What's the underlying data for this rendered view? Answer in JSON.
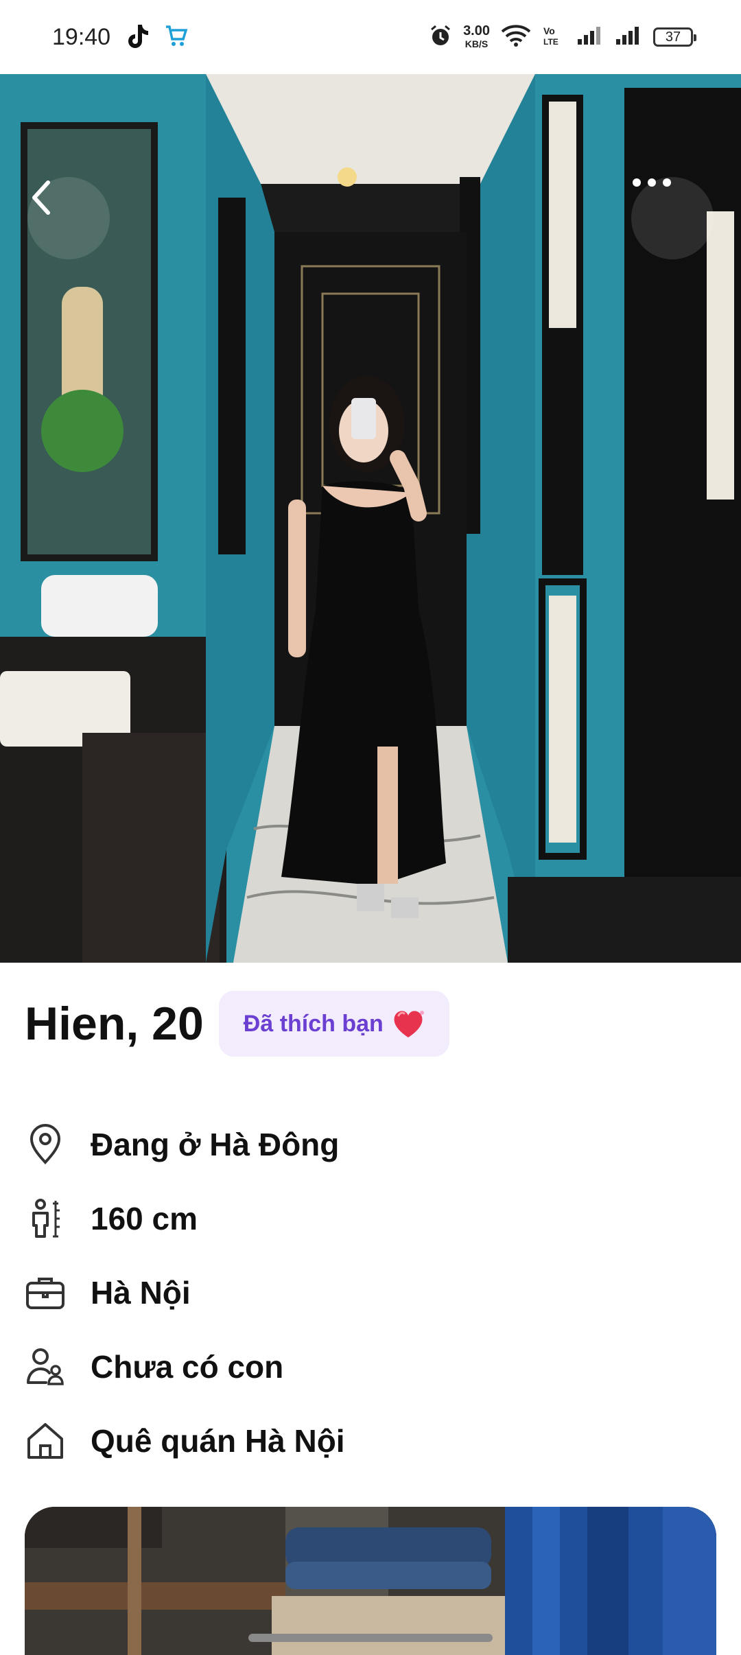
{
  "status_bar": {
    "time": "19:40",
    "speed_value": "3.00",
    "speed_unit": "KB/S",
    "battery": "37",
    "icons": [
      "tiktok-icon",
      "shopping-cart-icon",
      "alarm-icon",
      "wifi-icon",
      "volte-icon",
      "signal-icon",
      "signal-icon",
      "battery-icon"
    ]
  },
  "profile": {
    "name_age": "Hien, 20",
    "liked_badge": "Đã thích bạn",
    "badge_icon": "heart-icon",
    "attributes": [
      {
        "icon": "location-pin-icon",
        "text": "Đang ở Hà Đông"
      },
      {
        "icon": "height-icon",
        "text": "160 cm"
      },
      {
        "icon": "briefcase-icon",
        "text": "Hà Nội"
      },
      {
        "icon": "children-icon",
        "text": "Chưa có con"
      },
      {
        "icon": "home-icon",
        "text": "Quê quán Hà Nội"
      }
    ]
  },
  "colors": {
    "badge_bg": "#f3ecfd",
    "badge_text": "#6a3fd1",
    "heart": "#e8334f",
    "teal_wall": "#2a8fa3"
  }
}
